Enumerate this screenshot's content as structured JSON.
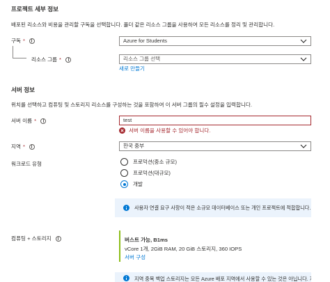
{
  "project": {
    "title": "프로젝트 세부 정보",
    "description": "배포된 리소스와 비용을 관리할 구독을 선택합니다. 폴더 같은 리소스 그룹을 사용하여 모든 리소스를 정리 및 관리합니다.",
    "subscription": {
      "label": "구독",
      "required": "*",
      "value": "Azure for Students"
    },
    "resource_group": {
      "label": "리소스 그룹",
      "required": "*",
      "placeholder": "리소스 그룹 선택",
      "create_new": "새로 만들기"
    }
  },
  "server": {
    "title": "서버 정보",
    "description": "위치를 선택하고 컴퓨팅 및 스토리지 리소스를 구성하는 것을 포함하여 이 서버 그룹의 필수 설정을 입력합니다.",
    "name": {
      "label": "서버 이름",
      "required": "*",
      "value": "test",
      "error": "서버 이름을 사용할 수 있어야 합니다."
    },
    "region": {
      "label": "지역",
      "required": "*",
      "value": "한국 중부"
    },
    "workload": {
      "label": "워크로드 유형",
      "options": [
        {
          "label": "프로덕션(중소 규모)",
          "selected": false
        },
        {
          "label": "프로덕션(대규모)",
          "selected": false
        },
        {
          "label": "개발",
          "selected": true
        }
      ],
      "info": "사용자 연결 요구 사항이 적은 소규모 데이터베이스 또는 개인 프로젝트에 적합합니다."
    },
    "compute": {
      "label": "컴퓨팅 + 스토리지",
      "tier": "버스트 가능, B1ms",
      "spec": "vCore 1개, 2GiB RAM, 20 GiB 스토리지, 360 IOPS",
      "configure_link": "서버 구성"
    },
    "bottom_info": "지역 중복 백업 스토리지는 모든 Azure 배포 지역에서 사용할 수 있는 것은 아닙니다. 지리적"
  },
  "colors": {
    "accent": "#0078d4",
    "error": "#a4262c",
    "info_bg": "#ebf3fc",
    "compute_bar": "#8cbd18"
  }
}
